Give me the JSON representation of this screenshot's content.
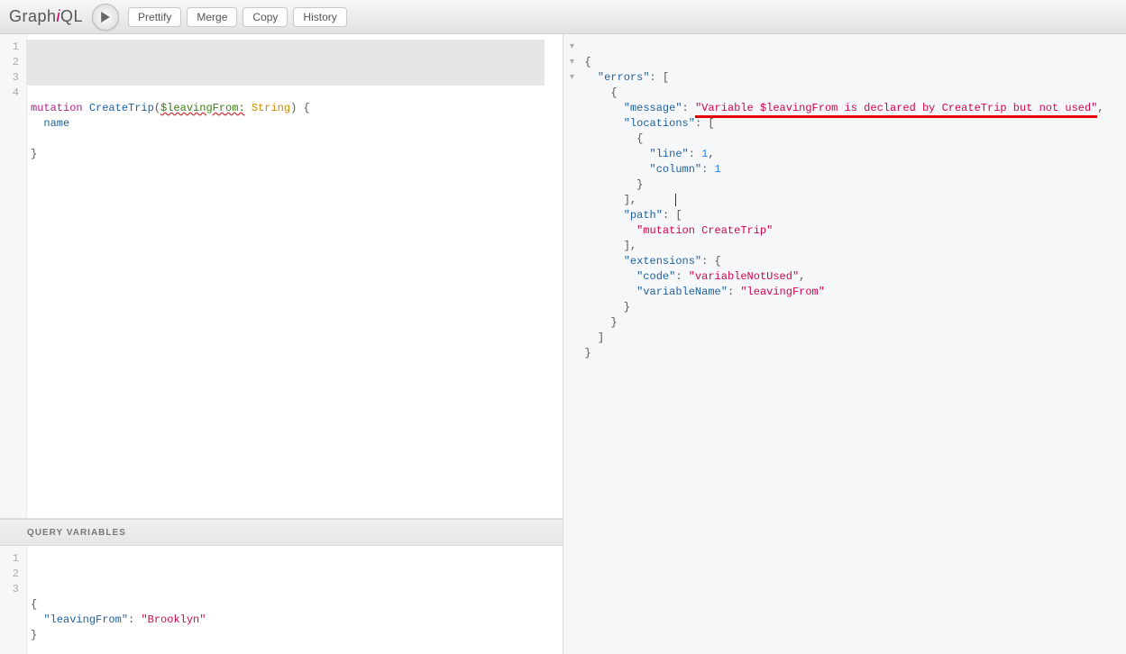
{
  "logo": {
    "part1": "Graph",
    "part2": "i",
    "part3": "QL"
  },
  "toolbar": {
    "prettify": "Prettify",
    "merge": "Merge",
    "copy": "Copy",
    "history": "History"
  },
  "editor": {
    "lines": [
      "1",
      "2",
      "3",
      "4"
    ],
    "l1": {
      "kw": "mutation",
      "name": "CreateTrip",
      "open": "(",
      "var": "$leavingFrom:",
      "type": "String",
      "close": ")",
      "brace": "{"
    },
    "l2": {
      "field": "name"
    },
    "l3": "",
    "l4": {
      "brace": "}"
    }
  },
  "vars": {
    "title": "QUERY VARIABLES",
    "lines": [
      "1",
      "2",
      "3"
    ],
    "l1": "{",
    "l2": {
      "key": "\"leavingFrom\"",
      "colon": ": ",
      "val": "\"Brooklyn\""
    },
    "l3": "}"
  },
  "result": {
    "r1": "{",
    "r2": {
      "key": "\"errors\"",
      "colon": ": ["
    },
    "r3": "{",
    "r4": {
      "key": "\"message\"",
      "colon": ": ",
      "val": "\"Variable $leavingFrom is declared by CreateTrip but not used\"",
      "comma": ","
    },
    "r5": {
      "key": "\"locations\"",
      "colon": ": ["
    },
    "r6": "{",
    "r7": {
      "key": "\"line\"",
      "colon": ": ",
      "num": "1",
      "comma": ","
    },
    "r8": {
      "key": "\"column\"",
      "colon": ": ",
      "num": "1"
    },
    "r9": "}",
    "r10": "],",
    "r11": {
      "key": "\"path\"",
      "colon": ": ["
    },
    "r12": {
      "val": "\"mutation CreateTrip\""
    },
    "r13": "],",
    "r14": {
      "key": "\"extensions\"",
      "colon": ": {"
    },
    "r15": {
      "key": "\"code\"",
      "colon": ": ",
      "val": "\"variableNotUsed\"",
      "comma": ","
    },
    "r16": {
      "key": "\"variableName\"",
      "colon": ": ",
      "val": "\"leavingFrom\""
    },
    "r17": "}",
    "r18": "}",
    "r19": "]",
    "r20": "}"
  }
}
